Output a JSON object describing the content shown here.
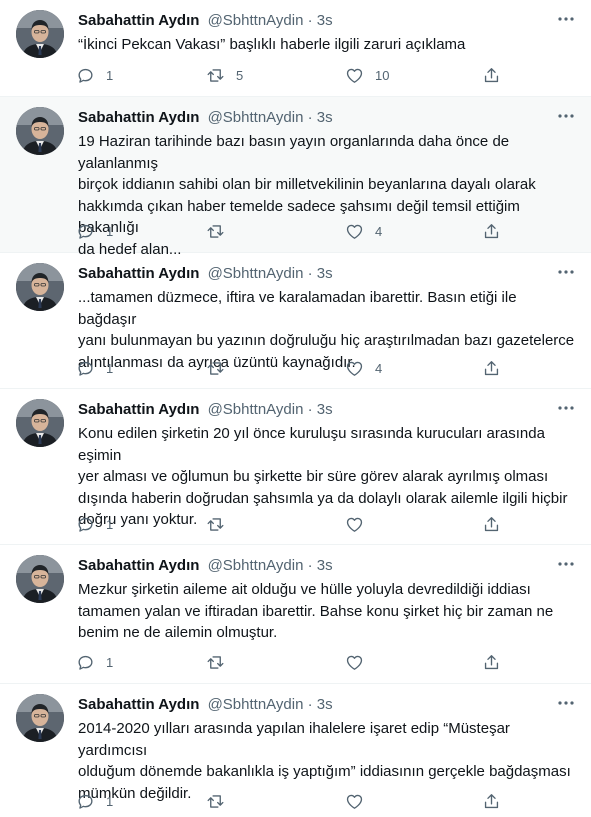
{
  "author": {
    "name": "Sabahattin Aydın",
    "handle": "@SbhttnAydin",
    "separator": "·",
    "time": "3s"
  },
  "tweets": [
    {
      "text": "“İkinci Pekcan Vakası” başlıklı haberle ilgili zaruri açıklama",
      "replies": "1",
      "retweets": "5",
      "likes": "10"
    },
    {
      "text": "19 Haziran tarihinde bazı basın yayın organlarında daha önce de yalanlanmış\nbirçok iddianın sahibi olan bir milletvekilinin beyanlarına dayalı olarak\nhakkımda çıkan haber temelde sadece şahsımı değil temsil ettiğim bakanlığı\nda hedef alan...",
      "replies": "1",
      "retweets": "",
      "likes": "4"
    },
    {
      "text": "...tamamen düzmece, iftira ve karalamadan ibarettir. Basın etiği ile bağdaşır\nyanı bulunmayan bu yazının doğruluğu hiç araştırılmadan bazı gazetelerce\nalıntılanması da ayrıca üzüntü kaynağıdır.",
      "replies": "1",
      "retweets": "",
      "likes": "4"
    },
    {
      "text": "Konu edilen şirketin 20 yıl önce kuruluşu sırasında kurucuları arasında eşimin\nyer alması ve oğlumun bu şirkette bir süre görev alarak ayrılmış olması\ndışında haberin doğrudan şahsımla ya da dolaylı olarak ailemle ilgili hiçbir\ndoğru yanı yoktur.",
      "replies": "1",
      "retweets": "",
      "likes": ""
    },
    {
      "text": "Mezkur şirketin aileme ait olduğu ve hülle yoluyla devredildiği iddiası\ntamamen yalan ve iftiradan ibarettir. Bahse konu şirket hiç bir zaman ne\nbenim ne de ailemin olmuştur.",
      "replies": "1",
      "retweets": "",
      "likes": ""
    },
    {
      "text": "2014-2020 yılları arasında yapılan ihalelere işaret edip “Müsteşar yardımcısı\nolduğum dönemde bakanlıkla iş yaptığım” iddiasının gerçekle bağdaşması\nmümkün değildir.",
      "replies": "1",
      "retweets": "",
      "likes": ""
    }
  ],
  "icons": {
    "reply": "reply-icon",
    "retweet": "retweet-icon",
    "like": "heart-icon",
    "share": "share-icon",
    "more": "more-options-icon"
  },
  "colors": {
    "text": "#0f1419",
    "secondary": "#536471",
    "divider": "#eff3f4",
    "focused_background": "#f7f9f9"
  }
}
